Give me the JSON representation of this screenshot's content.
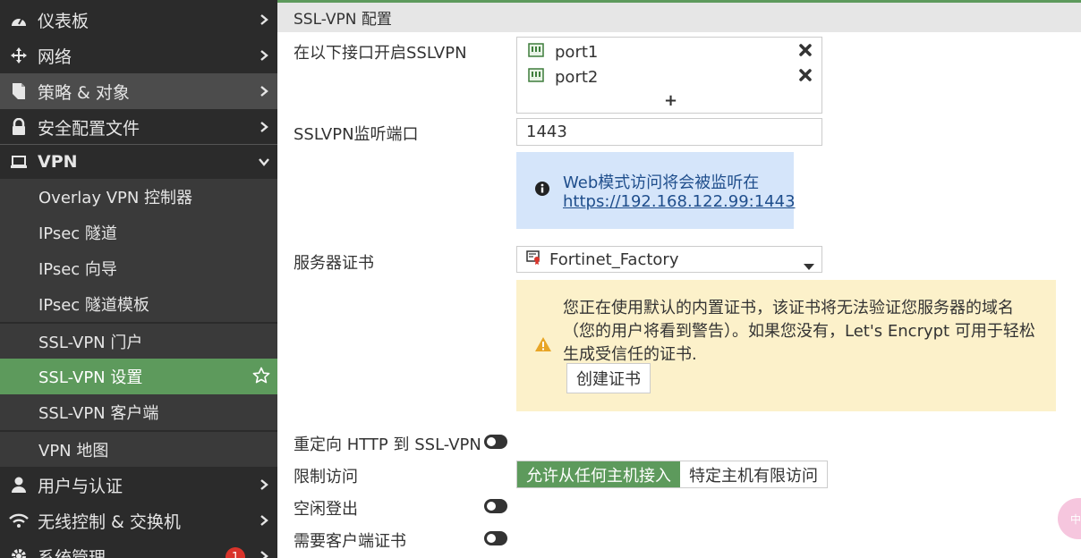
{
  "sidebar": {
    "items": [
      {
        "label": "仪表板",
        "icon": "dashboard-icon"
      },
      {
        "label": "网络",
        "icon": "network-move-icon"
      },
      {
        "label": "策略 & 对象",
        "icon": "policy-document-icon"
      },
      {
        "label": "安全配置文件",
        "icon": "lock-icon"
      },
      {
        "label": "VPN",
        "icon": "laptop-icon"
      }
    ],
    "vpn_subitems": [
      "Overlay VPN 控制器",
      "IPsec 隧道",
      "IPsec 向导",
      "IPsec 隧道模板",
      "SSL-VPN 门户",
      "SSL-VPN 设置",
      "SSL-VPN 客户端",
      "VPN 地图"
    ],
    "items_after": [
      {
        "label": "用户与认证",
        "icon": "user-icon"
      },
      {
        "label": "无线控制 & 交换机",
        "icon": "wifi-icon"
      },
      {
        "label": "系统管理",
        "icon": "gear-icon",
        "badge": "1"
      }
    ],
    "active_color": "#5d9a5c"
  },
  "main": {
    "section_title": "SSL-VPN 配置",
    "interfaces_label": "在以下接口开启SSLVPN",
    "interfaces": [
      "port1",
      "port2"
    ],
    "add_symbol": "+",
    "listen_port_label": "SSLVPN监听端口",
    "listen_port_value": "1443",
    "info_text": "Web模式访问将会被监听在",
    "info_link": "https://192.168.122.99:1443",
    "server_cert_label": "服务器证书",
    "server_cert_value": "Fortinet_Factory",
    "warning_text": "您正在使用默认的内置证书，该证书将无法验证您服务器的域名（您的用户将看到警告）。如果您没有，Let's Encrypt 可用于轻松生成受信任的证书.",
    "create_cert_button": "创建证书",
    "redirect_label": "重定向 HTTP 到 SSL-VPN",
    "restrict_label": "限制访问",
    "restrict_options": [
      "允许从任何主机接入",
      "特定主机有限访问"
    ],
    "idle_logout_label": "空闲登出",
    "require_client_cert_label": "需要客户端证书"
  },
  "floating_button": "中"
}
